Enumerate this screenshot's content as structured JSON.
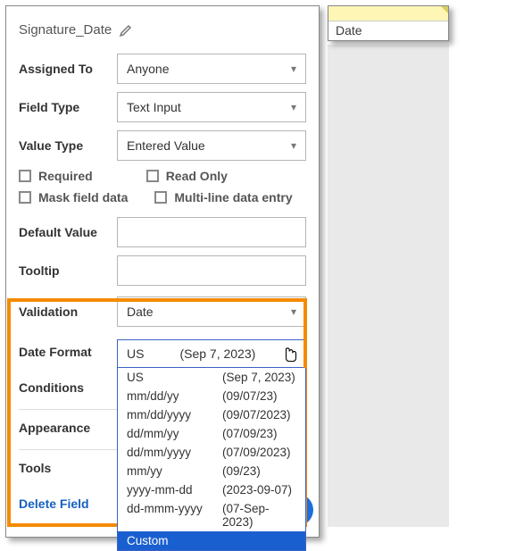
{
  "preview": {
    "label": "Date"
  },
  "fieldName": "Signature_Date",
  "rows": {
    "assignedTo": {
      "label": "Assigned To",
      "value": "Anyone"
    },
    "fieldType": {
      "label": "Field Type",
      "value": "Text Input"
    },
    "valueType": {
      "label": "Value Type",
      "value": "Entered Value"
    },
    "defaultValue": {
      "label": "Default Value",
      "value": ""
    },
    "tooltip": {
      "label": "Tooltip",
      "value": ""
    },
    "validation": {
      "label": "Validation",
      "value": "Date"
    },
    "dateFormat": {
      "label": "Date Format"
    }
  },
  "checkboxes": {
    "required": "Required",
    "readOnly": "Read Only",
    "maskFieldData": "Mask field data",
    "multiLine": "Multi-line data entry"
  },
  "sections": {
    "conditions": "Conditions",
    "appearance": "Appearance",
    "tools": "Tools"
  },
  "dateFormat": {
    "selected": {
      "fmt": "US",
      "ex": "(Sep 7, 2023)"
    },
    "options": [
      {
        "fmt": "US",
        "ex": "(Sep 7, 2023)"
      },
      {
        "fmt": "mm/dd/yy",
        "ex": "(09/07/23)"
      },
      {
        "fmt": "mm/dd/yyyy",
        "ex": "(09/07/2023)"
      },
      {
        "fmt": "dd/mm/yy",
        "ex": "(07/09/23)"
      },
      {
        "fmt": "dd/mm/yyyy",
        "ex": "(07/09/2023)"
      },
      {
        "fmt": "mm/yy",
        "ex": "(09/23)"
      },
      {
        "fmt": "yyyy-mm-dd",
        "ex": "(2023-09-07)"
      },
      {
        "fmt": "dd-mmm-yyyy",
        "ex": "(07-Sep-2023)"
      },
      {
        "fmt": "Custom",
        "ex": ""
      }
    ],
    "highlightedIndex": 8
  },
  "deleteField": "Delete Field"
}
